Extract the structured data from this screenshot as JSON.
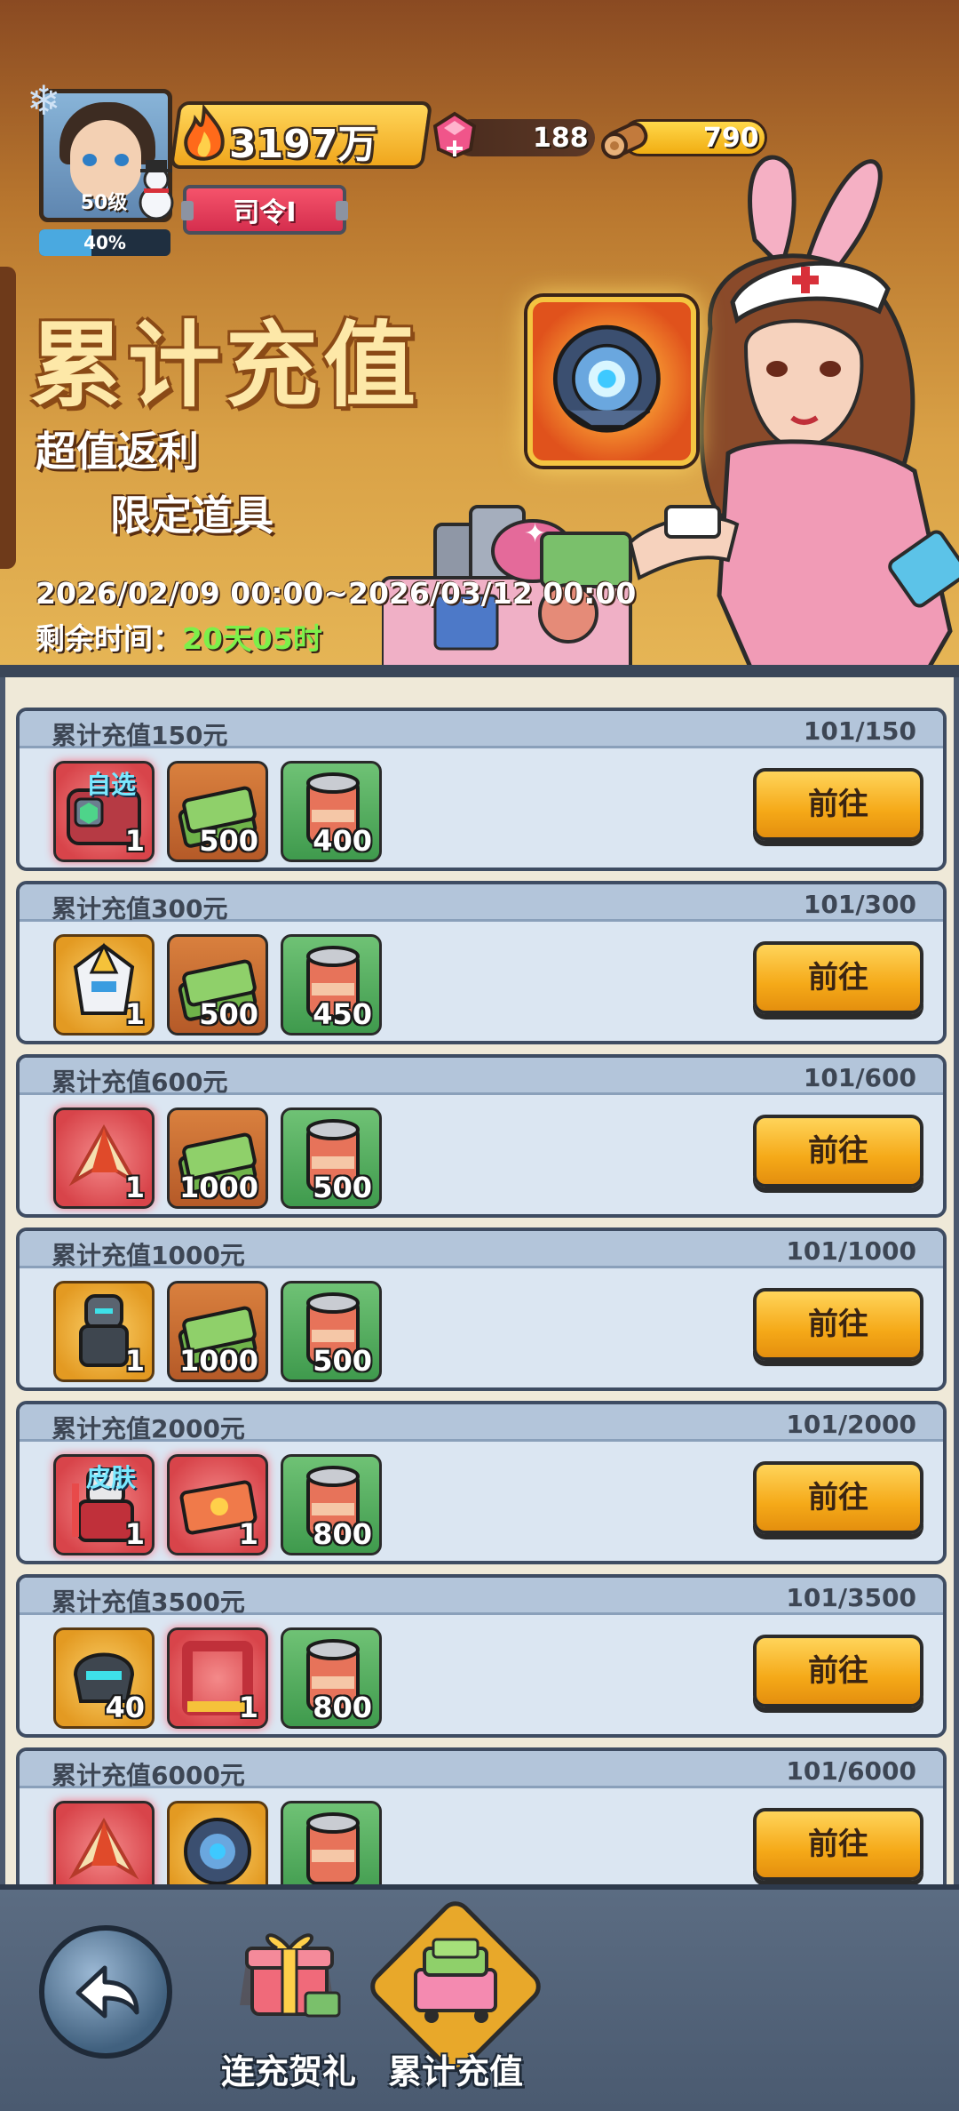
{
  "player": {
    "level": "50级",
    "xp_percent_text": "40%",
    "xp_fraction": 0.4,
    "power": "3197万",
    "rank": "司令I"
  },
  "currency": {
    "gems": "188",
    "wood": "790"
  },
  "event": {
    "title": "累计充值",
    "subtitle1": "超值返利",
    "subtitle2": "限定道具",
    "date_range": "2026/02/09 00:00~2026/03/12 00:00",
    "remaining_label": "剩余时间：",
    "remaining_value": "20天05时"
  },
  "tiers": [
    {
      "title": "累计充值150元",
      "progress": "101/150",
      "button": "前往",
      "items": [
        {
          "icon": "module-chest-icon",
          "style": "red",
          "qty": "1",
          "tag": "自选"
        },
        {
          "icon": "cash-stack-icon",
          "style": "brown",
          "qty": "500",
          "tag": ""
        },
        {
          "icon": "can-icon",
          "style": "green",
          "qty": "400",
          "tag": ""
        }
      ]
    },
    {
      "title": "累计充值300元",
      "progress": "101/300",
      "button": "前往",
      "items": [
        {
          "icon": "mech-helmet-icon",
          "style": "gold",
          "qty": "1",
          "tag": ""
        },
        {
          "icon": "cash-stack-icon",
          "style": "brown",
          "qty": "500",
          "tag": ""
        },
        {
          "icon": "can-icon",
          "style": "green",
          "qty": "450",
          "tag": ""
        }
      ]
    },
    {
      "title": "累计充值600元",
      "progress": "101/600",
      "button": "前往",
      "items": [
        {
          "icon": "phoenix-shard-icon",
          "style": "red",
          "qty": "1",
          "tag": ""
        },
        {
          "icon": "cash-stack-icon",
          "style": "brown",
          "qty": "1000",
          "tag": ""
        },
        {
          "icon": "can-icon",
          "style": "green",
          "qty": "500",
          "tag": ""
        }
      ]
    },
    {
      "title": "累计充值1000元",
      "progress": "101/1000",
      "button": "前往",
      "items": [
        {
          "icon": "dark-mech-icon",
          "style": "gold",
          "qty": "1",
          "tag": ""
        },
        {
          "icon": "cash-stack-icon",
          "style": "brown",
          "qty": "1000",
          "tag": ""
        },
        {
          "icon": "can-icon",
          "style": "green",
          "qty": "500",
          "tag": ""
        }
      ]
    },
    {
      "title": "累计充值2000元",
      "progress": "101/2000",
      "button": "前往",
      "items": [
        {
          "icon": "skin-warrior-icon",
          "style": "red",
          "qty": "1",
          "tag": "皮肤"
        },
        {
          "icon": "ticket-icon",
          "style": "red",
          "qty": "1",
          "tag": ""
        },
        {
          "icon": "can-icon",
          "style": "green",
          "qty": "800",
          "tag": ""
        }
      ]
    },
    {
      "title": "累计充值3500元",
      "progress": "101/3500",
      "button": "前往",
      "items": [
        {
          "icon": "helmet-shard-icon",
          "style": "gold",
          "qty": "40",
          "tag": ""
        },
        {
          "icon": "frame-icon",
          "style": "red",
          "qty": "1",
          "tag": ""
        },
        {
          "icon": "can-icon",
          "style": "green",
          "qty": "800",
          "tag": ""
        }
      ]
    },
    {
      "title": "累计充值6000元",
      "progress": "101/6000",
      "button": "前往",
      "items": [
        {
          "icon": "phoenix-shard-icon",
          "style": "red",
          "qty": "",
          "tag": ""
        },
        {
          "icon": "core-orb-icon",
          "style": "gold",
          "qty": "",
          "tag": ""
        },
        {
          "icon": "can-icon",
          "style": "green",
          "qty": "",
          "tag": ""
        }
      ]
    }
  ],
  "nav": {
    "tab1_label": "连充贺礼",
    "tab2_label": "累计充值"
  },
  "colors": {
    "accent_gold": "#f5a918",
    "remaining_green": "#7cf04a",
    "card_bg": "#dbe6f2"
  }
}
